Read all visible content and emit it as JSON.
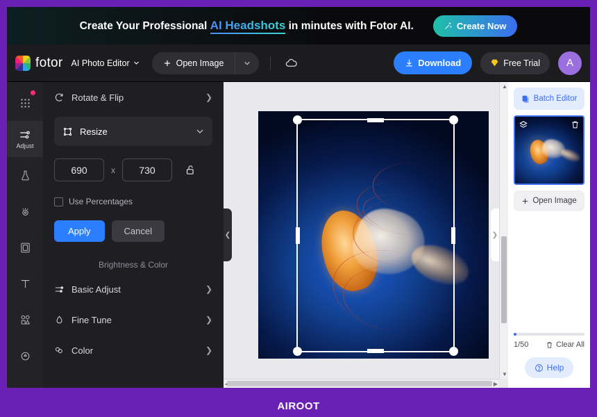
{
  "promo": {
    "text_before": "Create Your Professional ",
    "highlight": "AI Headshots",
    "text_after": " in minutes with Fotor AI.",
    "cta_label": "Create Now",
    "cta_icon": "sparkle-wand-icon"
  },
  "header": {
    "logo_text": "fotor",
    "editor_selector": "AI Photo Editor",
    "open_image_label": "Open Image",
    "cloud_icon": "cloud-icon",
    "download_label": "Download",
    "free_trial_label": "Free Trial",
    "avatar_initial": "A"
  },
  "rail": {
    "items": [
      {
        "name": "apps-grid",
        "icon": "grid-apps-icon",
        "label": "",
        "badge": true,
        "active": false
      },
      {
        "name": "adjust",
        "icon": "sliders-icon",
        "label": "Adjust",
        "badge": false,
        "active": true
      },
      {
        "name": "beauty",
        "icon": "flask-icon",
        "label": "",
        "badge": false,
        "active": false
      },
      {
        "name": "retouch",
        "icon": "eye-icon",
        "label": "",
        "badge": false,
        "active": false
      },
      {
        "name": "frame",
        "icon": "frame-icon",
        "label": "",
        "badge": false,
        "active": false
      },
      {
        "name": "text",
        "icon": "text-t-icon",
        "label": "",
        "badge": false,
        "active": false
      },
      {
        "name": "elements",
        "icon": "elements-icon",
        "label": "",
        "badge": false,
        "active": false
      },
      {
        "name": "effects",
        "icon": "droplet-icon",
        "label": "",
        "badge": false,
        "active": false
      }
    ]
  },
  "panel": {
    "rotate_flip_label": "Rotate & Flip",
    "resize_label": "Resize",
    "width_value": "690",
    "height_value": "730",
    "dim_separator": "x",
    "lock_icon": "unlocked-padlock-icon",
    "use_percentages_label": "Use Percentages",
    "apply_label": "Apply",
    "cancel_label": "Cancel",
    "section_title": "Brightness & Color",
    "rows": [
      {
        "label": "Basic Adjust",
        "icon": "sliders-icon"
      },
      {
        "label": "Fine Tune",
        "icon": "droplet-icon"
      },
      {
        "label": "Color",
        "icon": "color-icon"
      }
    ]
  },
  "canvas": {
    "collapse_left_icon": "chevron-left-icon",
    "collapse_right_icon": "chevron-right-icon",
    "image_subject": "jellyfish-photo"
  },
  "right_panel": {
    "batch_editor_label": "Batch Editor",
    "batch_icon": "stacked-documents-icon",
    "layers_icon": "layers-icon",
    "delete_icon": "trash-icon",
    "open_image_label": "Open Image",
    "counter": "1/50",
    "clear_all_label": "Clear All",
    "clear_icon": "trash-icon",
    "help_label": "Help",
    "help_icon": "question-circle-icon",
    "progress_percent": 4
  },
  "watermark": {
    "text": "AIROOT"
  },
  "colors": {
    "accent_blue": "#2b7fff",
    "brand_purple": "#6a1fb5",
    "panel_bg": "#1f1f23",
    "badge_pink": "#ff2d6f"
  }
}
